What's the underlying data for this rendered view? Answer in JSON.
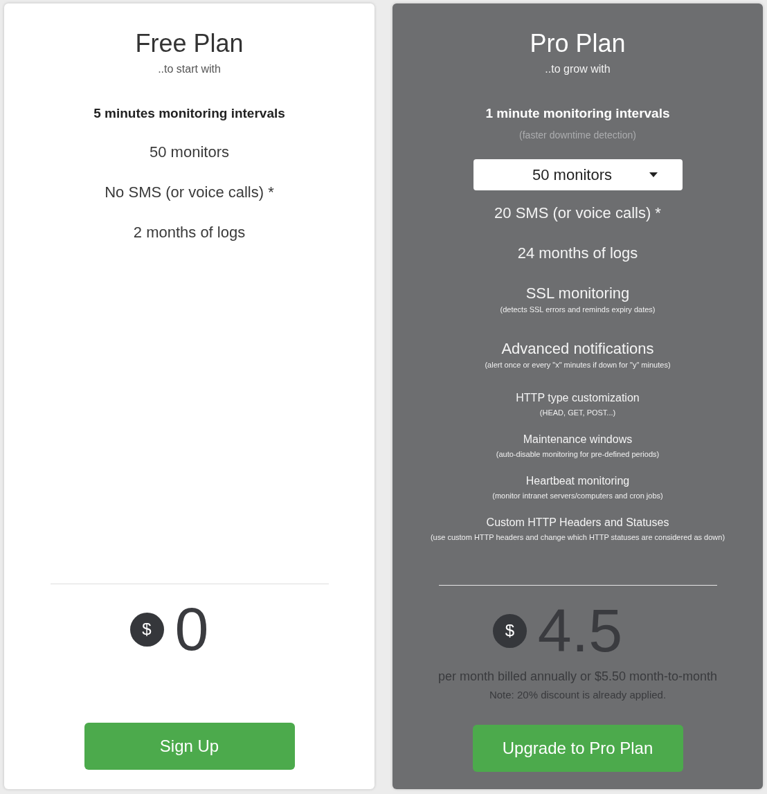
{
  "plans": [
    {
      "kind": "standard",
      "title": "Free Plan",
      "subtitle": "..to start with",
      "features": [
        {
          "kind": "emphasis",
          "label": "5 minutes monitoring intervals"
        },
        {
          "kind": "large",
          "label": "50 monitors"
        },
        {
          "kind": "large",
          "label": "No SMS (or voice calls) *"
        },
        {
          "kind": "large",
          "label": "2 months of logs"
        }
      ],
      "price": {
        "currency": "$",
        "amount": "0"
      },
      "button": "Sign Up"
    },
    {
      "kind": "highlighted",
      "title": "Pro Plan",
      "subtitle": "..to grow with",
      "features": [
        {
          "kind": "emphasis",
          "label": "1 minute monitoring intervals",
          "note": "(faster downtime detection)"
        },
        {
          "kind": "dropdown",
          "value": "50 monitors"
        },
        {
          "kind": "large",
          "label": "20 SMS (or voice calls) *"
        },
        {
          "kind": "large",
          "label": "24 months of logs"
        },
        {
          "kind": "large",
          "label": "SSL monitoring",
          "note": "(detects SSL errors and reminds expiry dates)"
        },
        {
          "kind": "large",
          "label": "Advanced notifications",
          "note": "(alert once or every \"x\" minutes if down for \"y\" minutes)"
        },
        {
          "kind": "small",
          "label": "HTTP type customization",
          "note": "(HEAD, GET, POST...)"
        },
        {
          "kind": "small",
          "label": "Maintenance windows",
          "note": "(auto-disable monitoring for pre-defined periods)"
        },
        {
          "kind": "small",
          "label": "Heartbeat monitoring",
          "note": "(monitor intranet servers/computers and cron jobs)"
        },
        {
          "kind": "small",
          "label": "Custom HTTP Headers and Statuses",
          "note": "(use custom HTTP headers and change which HTTP statuses are considered as down)"
        }
      ],
      "price": {
        "currency": "$",
        "amount": "4.5",
        "billing": "per month billed annually or $5.50 month-to-month",
        "note": "Note: 20% discount is already applied."
      },
      "button": "Upgrade to Pro Plan"
    }
  ]
}
